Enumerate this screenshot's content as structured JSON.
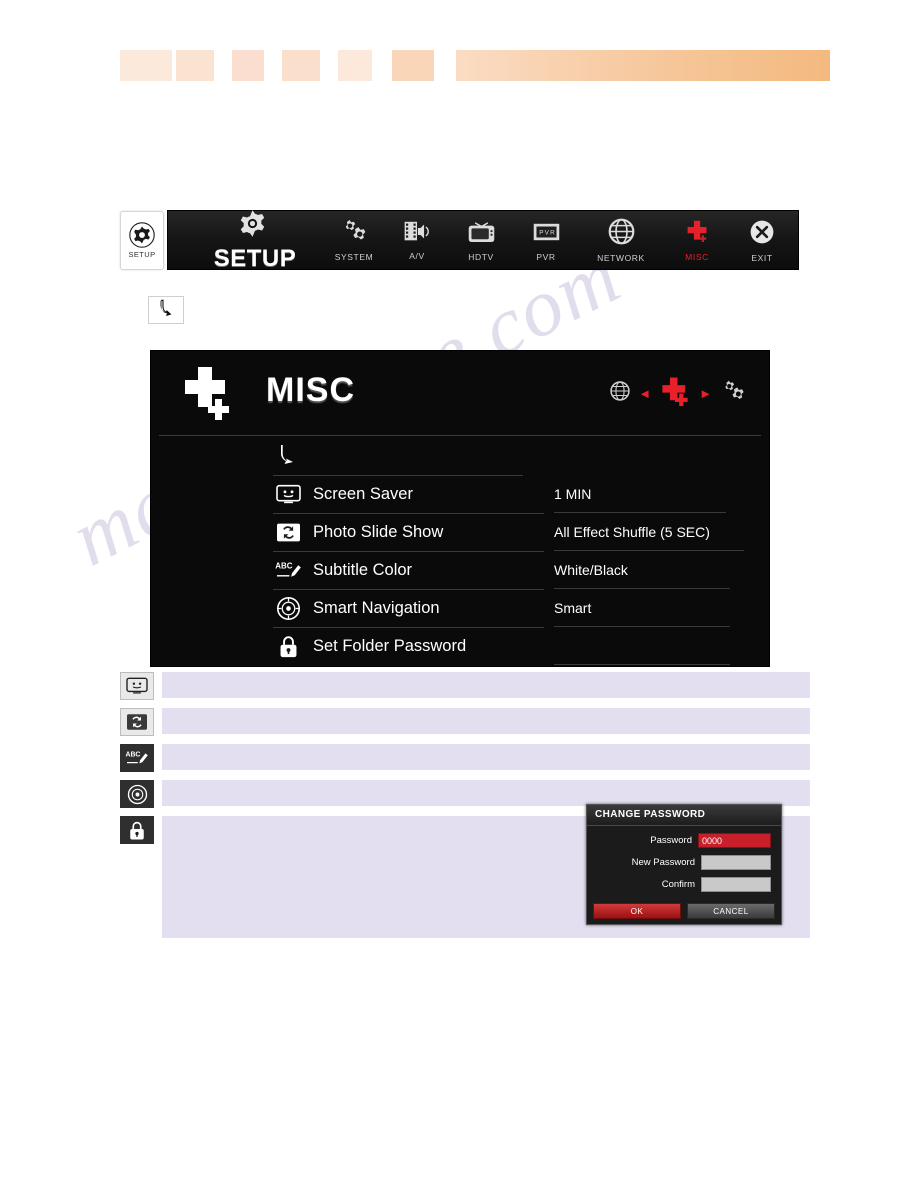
{
  "header": {
    "bands": [
      "",
      "",
      "",
      "",
      "",
      "",
      ""
    ]
  },
  "watermark": {
    "text": "manualshive.com"
  },
  "setup_badge": {
    "label": "SETUP",
    "icon": "gear-icon"
  },
  "topbar": {
    "title": "SETUP",
    "items": [
      {
        "label": "SETUP",
        "icon": "gear-icon",
        "active": false
      },
      {
        "label": "SYSTEM",
        "icon": "gears-icon",
        "active": false
      },
      {
        "label": "A/V",
        "icon": "film-speaker-icon",
        "active": false
      },
      {
        "label": "HDTV",
        "icon": "tv-icon",
        "active": false
      },
      {
        "label": "PVR",
        "icon": "pvr-icon",
        "active": false
      },
      {
        "label": "NETWORK",
        "icon": "globe-icon",
        "active": false
      },
      {
        "label": "MISC",
        "icon": "plus-icon",
        "active": true
      },
      {
        "label": "EXIT",
        "icon": "close-circle-icon",
        "active": false
      }
    ]
  },
  "back_button": {
    "icon": "return-arrow-icon"
  },
  "panel": {
    "title": "MISC",
    "icon": "plus-icon",
    "nav": {
      "prev_icon": "globe-icon",
      "left_arrow": "◄",
      "current_icon": "plus-icon",
      "right_arrow": "►",
      "next_icon": "gears-icon"
    },
    "return_row": {
      "icon": "return-arrow-icon"
    },
    "rows": [
      {
        "icon": "screen-saver-icon",
        "label": "Screen Saver",
        "value": "1 MIN"
      },
      {
        "icon": "photo-slideshow-icon",
        "label": "Photo Slide Show",
        "value": "All Effect Shuffle (5 SEC)"
      },
      {
        "icon": "subtitle-color-icon",
        "label": "Subtitle Color",
        "value": "White/Black"
      },
      {
        "icon": "smart-navigation-icon",
        "label": "Smart Navigation",
        "value": "Smart"
      },
      {
        "icon": "lock-icon",
        "label": "Set Folder Password",
        "value": ""
      }
    ]
  },
  "descriptions": [
    {
      "icon": "screen-saver-icon",
      "text": ""
    },
    {
      "icon": "photo-slideshow-icon",
      "text": ""
    },
    {
      "icon": "subtitle-color-icon",
      "text": ""
    },
    {
      "icon": "smart-navigation-icon",
      "text": ""
    },
    {
      "icon": "lock-icon",
      "text": ""
    }
  ],
  "password_dialog": {
    "title": "CHANGE PASSWORD",
    "fields": [
      {
        "label": "Password",
        "value": "0000",
        "active": true
      },
      {
        "label": "New Password",
        "value": "",
        "active": false
      },
      {
        "label": "Confirm",
        "value": "",
        "active": false
      }
    ],
    "ok_label": "OK",
    "cancel_label": "CANCEL"
  },
  "colors": {
    "accent_red": "#e8202a",
    "panel_bg": "#0a0a0a",
    "band_purple": "#e4dff0",
    "header_orange": "#f3b97f"
  }
}
